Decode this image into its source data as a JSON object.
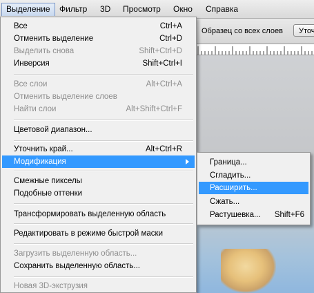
{
  "menubar": {
    "items": [
      "Выделение",
      "Фильтр",
      "3D",
      "Просмотр",
      "Окно",
      "Справка"
    ]
  },
  "options_bar": {
    "sample_all_layers": "Образец со всех слоев",
    "refine_button": "Уточ"
  },
  "select_menu": {
    "items": [
      {
        "label": "Все",
        "shortcut": "Ctrl+A",
        "disabled": false
      },
      {
        "label": "Отменить выделение",
        "shortcut": "Ctrl+D",
        "disabled": false
      },
      {
        "label": "Выделить снова",
        "shortcut": "Shift+Ctrl+D",
        "disabled": true
      },
      {
        "label": "Инверсия",
        "shortcut": "Shift+Ctrl+I",
        "disabled": false
      },
      {
        "label": "Все слои",
        "shortcut": "Alt+Ctrl+A",
        "disabled": true
      },
      {
        "label": "Отменить выделение слоев",
        "shortcut": "",
        "disabled": true
      },
      {
        "label": "Найти слои",
        "shortcut": "Alt+Shift+Ctrl+F",
        "disabled": true
      },
      {
        "label": "Цветовой диапазон...",
        "shortcut": "",
        "disabled": false
      },
      {
        "label": "Уточнить край...",
        "shortcut": "Alt+Ctrl+R",
        "disabled": false
      },
      {
        "label": "Модификация",
        "shortcut": "",
        "disabled": false,
        "highlight": true,
        "submenu": true
      },
      {
        "label": "Смежные пикселы",
        "shortcut": "",
        "disabled": false
      },
      {
        "label": "Подобные оттенки",
        "shortcut": "",
        "disabled": false
      },
      {
        "label": "Трансформировать выделенную область",
        "shortcut": "",
        "disabled": false
      },
      {
        "label": "Редактировать в режиме быстрой маски",
        "shortcut": "",
        "disabled": false
      },
      {
        "label": "Загрузить выделенную область...",
        "shortcut": "",
        "disabled": true
      },
      {
        "label": "Сохранить выделенную область...",
        "shortcut": "",
        "disabled": false
      },
      {
        "label": "Новая 3D-экструзия",
        "shortcut": "",
        "disabled": true
      }
    ]
  },
  "modify_submenu": {
    "items": [
      {
        "label": "Граница...",
        "shortcut": ""
      },
      {
        "label": "Сгладить...",
        "shortcut": ""
      },
      {
        "label": "Расширить...",
        "shortcut": "",
        "highlight": true
      },
      {
        "label": "Сжать...",
        "shortcut": ""
      },
      {
        "label": "Растушевка...",
        "shortcut": "Shift+F6"
      }
    ]
  }
}
